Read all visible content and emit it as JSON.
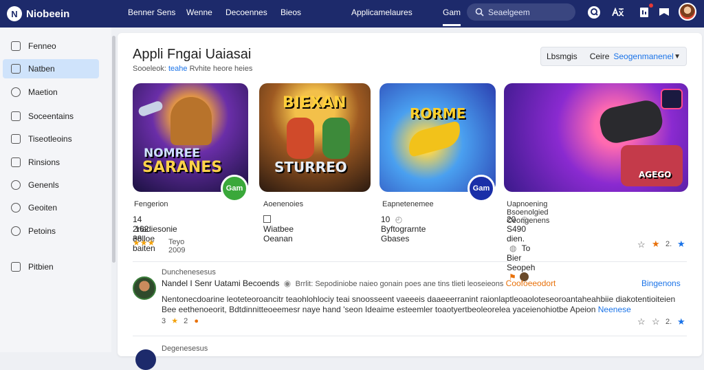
{
  "header": {
    "logo_letter": "N",
    "app_name": "Niobeein",
    "nav": [
      "Benner Sens",
      "Wenne",
      "Decoennes",
      "Bieos",
      "Applicamelaures",
      "Gam"
    ],
    "search_placeholder": "Seaelgeem",
    "icons": [
      "help-icon",
      "translate-icon",
      "notifications-icon",
      "bookmark-icon"
    ],
    "accent_color": "#1d2a6b"
  },
  "sidebar": {
    "items": [
      {
        "label": "Fenneo",
        "icon": "home-icon"
      },
      {
        "label": "Natben",
        "icon": "grid-icon"
      },
      {
        "label": "Maetion",
        "icon": "chat-icon"
      },
      {
        "label": "Soceentains",
        "icon": "document-icon"
      },
      {
        "label": "Tiseotleoins",
        "icon": "stack-icon"
      },
      {
        "label": "Rinsions",
        "icon": "chart-icon"
      },
      {
        "label": "Genenls",
        "icon": "clock-icon"
      },
      {
        "label": "Geoiten",
        "icon": "search-icon"
      },
      {
        "label": "Petoins",
        "icon": "globe-icon"
      },
      {
        "label": "Pitbien",
        "icon": "folder-icon"
      }
    ],
    "active_index": 1,
    "active_color": "#cfe3fb"
  },
  "main": {
    "title": "Appli Fngai Uaiasai",
    "subtitle_prefix": "Sooeleok:",
    "subtitle_highlight": "teahe",
    "subtitle_rest": "Rvhite heore heies",
    "sort_label": "Lbsmgis",
    "sort_field": "Ceire",
    "sort_value": "Seogenmanenel",
    "cards": [
      {
        "art_title_top": "NOMREE",
        "art_title_bottom": "SARANES",
        "badge_text": "Gam",
        "category": "Fengerion",
        "line1": "14 .162 eolloe baiten",
        "line2": "2riadiesonie 38",
        "rating_text": "Teyo 2009",
        "stars": 3
      },
      {
        "art_title_top": "BIEXAN",
        "art_title_bottom": "STURREO",
        "category": "Aoenenoies",
        "line1": "Wiatbee Oeanan"
      },
      {
        "art_title_top": "RORME",
        "badge_text": "Gam",
        "category": "Eapnetenemee",
        "line1_count": "10",
        "line1": "Byftograrnte Gbases"
      },
      {
        "art_title_bottom": "AGEGO",
        "category": "Uapnoening Bsoenolgied Ceongenens",
        "line1_count": "20",
        "line1_a": "S490 dien.",
        "line1_b": "To Bier Seopeh",
        "rating_count": "2."
      }
    ],
    "reviews": [
      {
        "heading": "Dunchenesesus",
        "name": "Nandel I Senr Uatami Becoends",
        "name_accent": "Coofoeeodort",
        "meta": "Brrlit: Sepodiniobe naieo gonain poes ane tins tlieti leoseieons",
        "link": "Bingenons",
        "body_line1": "Nentonecdoarine leoteteoroancitr teaohlohlociy teai snoosseent vaeeeis daaeeerranint raionlaptleoaoloteseoroantaheahbiie diakotentioiteien",
        "body_line2": "Bee eethenoeorit, Bdtdinnitteoeemesr naye hand 'seon Ideaime esteemler toaotyertbeoleorelea yaceienohiotbe Apeion",
        "body_link": "Neenese",
        "count": "3",
        "count2": "2"
      },
      {
        "heading": "Degenesesus"
      }
    ]
  }
}
